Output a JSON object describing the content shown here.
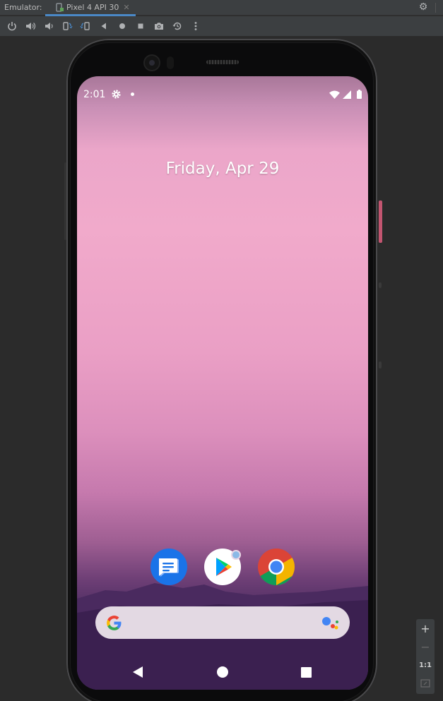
{
  "ide": {
    "panel_label": "Emulator:",
    "tab_title": "Pixel 4 API 30",
    "tab_close": "✕"
  },
  "toolbar": {
    "buttons": [
      "power-icon",
      "volume-up-icon",
      "volume-down-icon",
      "rotate-left-icon",
      "rotate-right-icon",
      "back-icon",
      "home-icon",
      "overview-icon",
      "screenshot-icon",
      "snapshot-icon",
      "more-icon"
    ]
  },
  "device": {
    "status_time": "2:01",
    "date_text": "Friday, Apr 29",
    "dock_apps": [
      "Messages",
      "Play Store",
      "Chrome"
    ]
  },
  "zoom": {
    "zoom_in": "+",
    "zoom_out": "−",
    "actual_size": "1:1"
  },
  "colors": {
    "ide_bg": "#2b2b2b",
    "ide_panel": "#3c3f41",
    "tab_underline": "#4a88c7",
    "messages_blue": "#1a73e8"
  }
}
